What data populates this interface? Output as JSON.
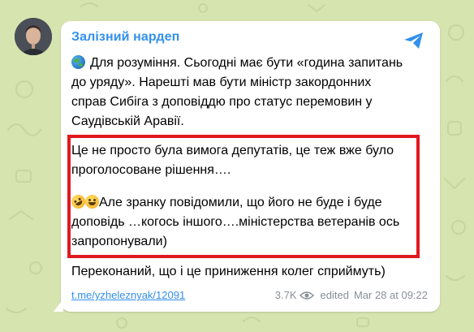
{
  "channel": {
    "author": "Залізний нардеп"
  },
  "message": {
    "paragraph1": "Для розуміння. Сьогодні має бути «година запитань\nдо уряду». Нарешті мав бути міністр закордонних\nсправ Сибіга з доповіддю про статус перемовин у\nСаудівській Аравії.",
    "paragraph2": "Це не просто була вимога депутатів, це теж вже було\nпроголосоване рішення….",
    "paragraph3": "Але зранку повідомили, що його не буде і буде\nдоповідь …когось іншого….міністерства ветеранів ось\nзапропонували)",
    "paragraph4": "Переконаний, що і це приниження колег сприймуть)",
    "link": "t.me/yzheleznyak/12091",
    "views": "3.7K",
    "edited_label": "edited",
    "timestamp": "Mar 28 at 09:22"
  },
  "icons": {
    "share": "share-icon",
    "views": "eye-icon",
    "globe": "globe-emoji",
    "rofl": "rofl-emoji",
    "grin": "grin-emoji"
  },
  "colors": {
    "background": "#d6e4b0",
    "accent": "#3390ec",
    "highlight": "#e0191f",
    "meta": "#8a8f96"
  }
}
